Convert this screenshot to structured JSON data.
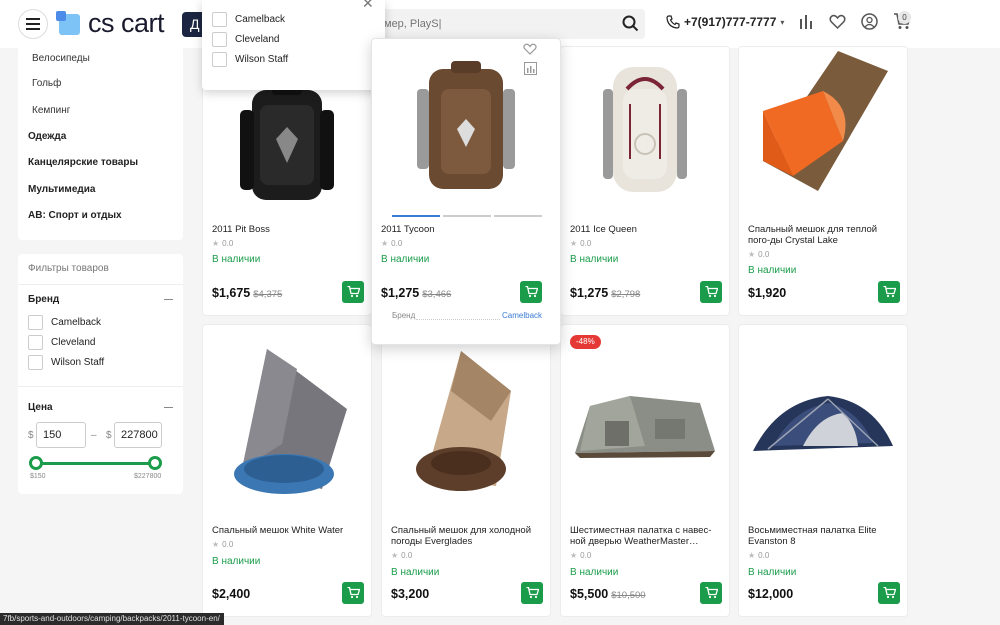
{
  "header": {
    "logo_text": "cs cart",
    "catalog_label": "Д",
    "search_placeholder": "мер, PlayS|",
    "phone": "+7(917)777-7777",
    "cart_count": "0",
    "accent": "#1c2541"
  },
  "dropdown": {
    "items": [
      "Camelback",
      "Cleveland",
      "Wilson Staff"
    ]
  },
  "sidebar": {
    "subcategories": [
      "Велосипеды",
      "Гольф",
      "Кемпинг"
    ],
    "categories": [
      "Одежда",
      "Канцелярские товары",
      "Мультимедиа",
      "AB: Спорт и отдых"
    ]
  },
  "filters": {
    "title": "Фильтры товаров",
    "brand_label": "Бренд",
    "brands": [
      "Camelback",
      "Cleveland",
      "Wilson Staff"
    ],
    "price_label": "Цена",
    "currency": "$",
    "dash": "–",
    "price_from": "150",
    "price_to": "227800",
    "min_label": "$150",
    "max_label": "$227800"
  },
  "products": [
    {
      "name": "2011 Pit Boss",
      "rating": "0.0",
      "stock": "В наличии",
      "price": "$1,675",
      "old_price": "$4,375",
      "badge": ""
    },
    {
      "name": "2011 Tycoon",
      "rating": "0.0",
      "stock": "В наличии",
      "price": "$1,275",
      "old_price": "$3,466",
      "badge": "",
      "feature_label": "Бренд",
      "feature_value": "Camelback"
    },
    {
      "name": "2011 Ice Queen",
      "rating": "0.0",
      "stock": "В наличии",
      "price": "$1,275",
      "old_price": "$2,798",
      "badge": ""
    },
    {
      "name": "Спальный мешок для теплой пого-ды Crystal Lake",
      "rating": "0.0",
      "stock": "В наличии",
      "price": "$1,920",
      "old_price": "",
      "badge": ""
    },
    {
      "name": "Спальный мешок White Water",
      "rating": "0.0",
      "stock": "В наличии",
      "price": "$2,400",
      "old_price": "",
      "badge": ""
    },
    {
      "name": "Спальный мешок для холодной погоды Everglades",
      "rating": "0.0",
      "stock": "В наличии",
      "price": "$3,200",
      "old_price": "",
      "badge": ""
    },
    {
      "name": "Шестиместная палатка с навес-ной дверью WeatherMaster…",
      "rating": "0.0",
      "stock": "В наличии",
      "price": "$5,500",
      "old_price": "$10,500",
      "badge": "-48%"
    },
    {
      "name": "Восьмиместная палатка Elite Evanston 8",
      "rating": "0.0",
      "stock": "В наличии",
      "price": "$12,000",
      "old_price": "",
      "badge": ""
    }
  ],
  "status_url": "7fb/sports-and-outdoors/camping/backpacks/2011-tycoon-en/",
  "colors": {
    "green": "#1a9c4a",
    "badge_red": "#e53935",
    "navy": "#1c2541"
  }
}
